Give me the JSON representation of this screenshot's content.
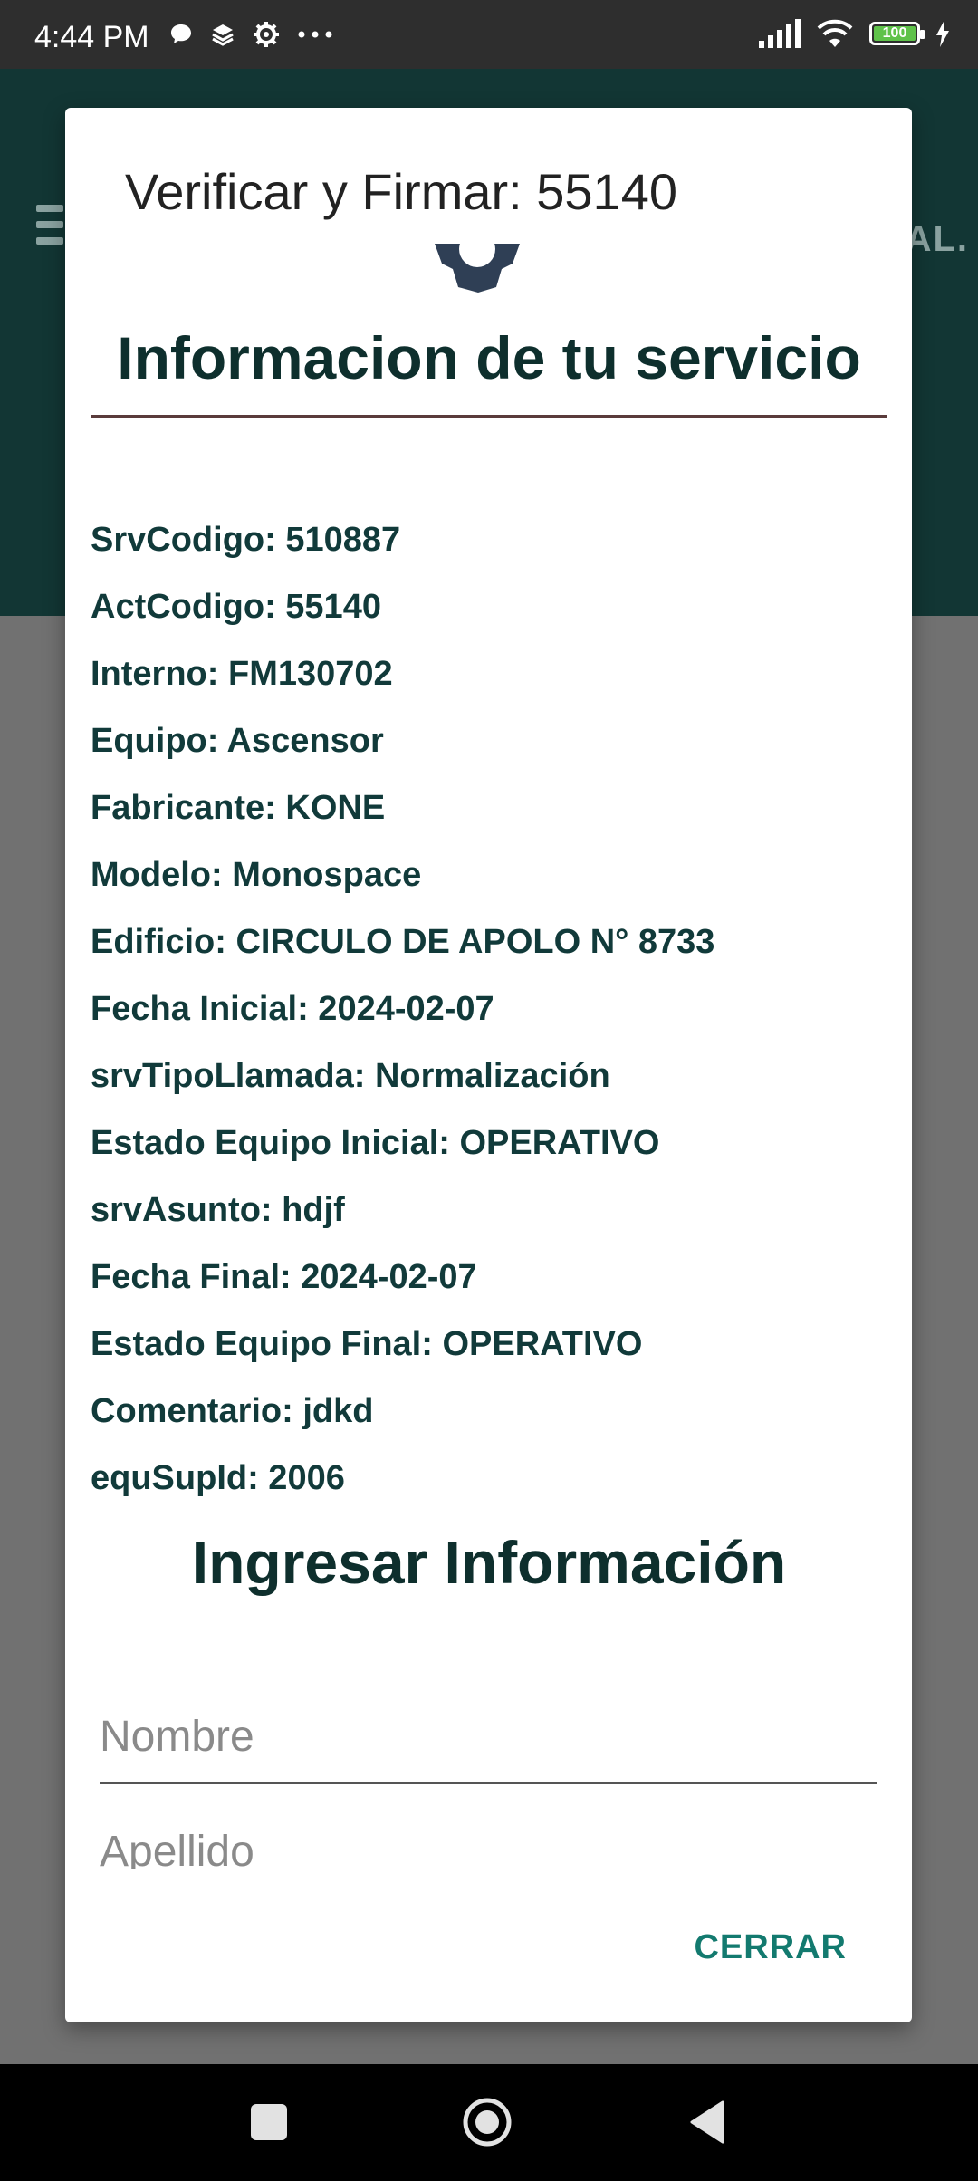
{
  "status_bar": {
    "time": "4:44 PM",
    "battery": "100",
    "icons_left": [
      "chat-bubble-icon",
      "layers-icon",
      "gear-icon",
      "more-dots-icon"
    ],
    "icons_right": [
      "signal-icon",
      "wifi-icon",
      "battery-icon",
      "charging-icon"
    ]
  },
  "dialog": {
    "title": "Verificar y Firmar: 55140",
    "section_title": "Informacion de tu servicio",
    "info": [
      "SrvCodigo: 510887",
      "ActCodigo: 55140",
      "Interno: FM130702",
      "Equipo: Ascensor",
      "Fabricante: KONE",
      "Modelo: Monospace",
      "Edificio: CIRCULO DE APOLO N° 8733",
      "Fecha Inicial: 2024-02-07",
      "srvTipoLlamada: Normalización",
      "Estado Equipo Inicial: OPERATIVO",
      "srvAsunto: hdjf",
      "Fecha Final: 2024-02-07",
      "Estado Equipo Final: OPERATIVO",
      "Comentario: jdkd",
      "equSupId: 2006"
    ],
    "input_title": "Ingresar Información",
    "fields": {
      "nombre_placeholder": "Nombre",
      "apellido_placeholder": "Apellido"
    },
    "close_label": "CERRAR"
  },
  "colors": {
    "header_bg": "#123634",
    "text_dark": "#0e2f2d",
    "accent": "#137a6f",
    "battery_fill": "#5fc24a"
  }
}
